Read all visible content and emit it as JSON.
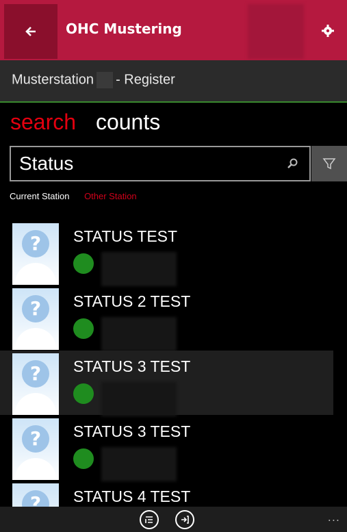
{
  "header": {
    "title": "OHC Mustering",
    "back_icon": "back-arrow-icon",
    "settings_icon": "gear-icon"
  },
  "subheader": {
    "prefix": "Musterstation",
    "suffix": "- Register"
  },
  "pivot": {
    "tabs": [
      {
        "label": "search",
        "active": true
      },
      {
        "label": "counts",
        "active": false
      }
    ]
  },
  "search": {
    "value": "Status"
  },
  "legend": {
    "current": "Current Station",
    "other": "Other Station"
  },
  "results": [
    {
      "name": "STATUS TEST",
      "status_color": "#1f8c1f",
      "selected": false
    },
    {
      "name": "STATUS 2 TEST",
      "status_color": "#1f8c1f",
      "selected": false
    },
    {
      "name": "STATUS 3 TEST",
      "status_color": "#1f8c1f",
      "selected": true
    },
    {
      "name": "STATUS 3 TEST",
      "status_color": "#1f8c1f",
      "selected": false
    },
    {
      "name": "STATUS 4 TEST",
      "status_color": "#1f8c1f",
      "selected": false
    }
  ],
  "colors": {
    "brand": "#b5193f",
    "accent": "#e3000f",
    "present": "#1f8c1f"
  },
  "appbar": {
    "more": "..."
  }
}
